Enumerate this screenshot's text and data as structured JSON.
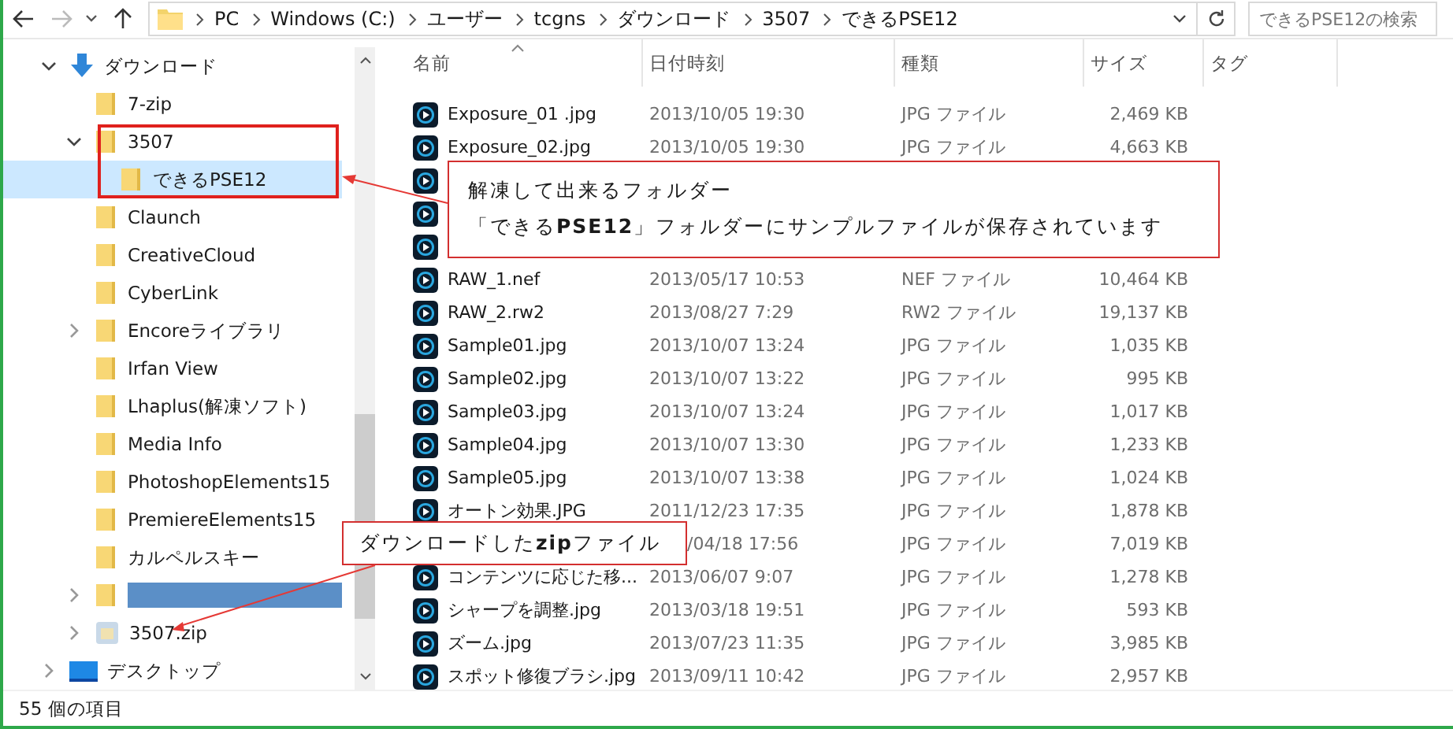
{
  "address_bar": {
    "segments": [
      "PC",
      "Windows (C:)",
      "ユーザー",
      "tcgns",
      "ダウンロード",
      "3507",
      "できるPSE12"
    ]
  },
  "search": {
    "placeholder": "できるPSE12の検索"
  },
  "tree": [
    {
      "label": "ダウンロード",
      "kind": "download",
      "expanded": true,
      "selected": false,
      "children": [
        {
          "label": "7-zip",
          "kind": "folder",
          "selected": false
        },
        {
          "label": "3507",
          "kind": "folder",
          "expanded": true,
          "selected": false,
          "children": [
            {
              "label": "できるPSE12",
              "kind": "folder",
              "selected": true
            }
          ]
        },
        {
          "label": "Claunch",
          "kind": "folder",
          "selected": false
        },
        {
          "label": "CreativeCloud",
          "kind": "folder",
          "selected": false
        },
        {
          "label": "CyberLink",
          "kind": "folder",
          "selected": false
        },
        {
          "label": "Encoreライブラリ",
          "kind": "folder",
          "expanded": false,
          "selected": false
        },
        {
          "label": "Irfan View",
          "kind": "folder",
          "selected": false
        },
        {
          "label": "Lhaplus(解凍ソフト)",
          "kind": "folder",
          "selected": false
        },
        {
          "label": "Media Info",
          "kind": "folder",
          "selected": false
        },
        {
          "label": "PhotoshopElements15",
          "kind": "folder",
          "selected": false
        },
        {
          "label": "PremiereElements15",
          "kind": "folder",
          "selected": false
        },
        {
          "label": "カルペルスキー",
          "kind": "folder",
          "selected": false
        },
        {
          "kind": "redacted",
          "expanded": false,
          "selected": false
        },
        {
          "label": "3507.zip",
          "kind": "zip",
          "expanded": false,
          "selected": false
        }
      ]
    },
    {
      "label": "デスクトップ",
      "kind": "desktop",
      "expanded": false,
      "selected": false
    }
  ],
  "columns": [
    "名前",
    "日付時刻",
    "種類",
    "サイズ",
    "タグ"
  ],
  "files": [
    {
      "name": "Exposure_01 .jpg",
      "date": "2013/10/05 19:30",
      "type": "JPG ファイル",
      "size": "2,469 KB"
    },
    {
      "name": "Exposure_02.jpg",
      "date": "2013/10/05 19:30",
      "type": "JPG ファイル",
      "size": "4,663 KB"
    },
    {
      "kind": "covered"
    },
    {
      "kind": "covered"
    },
    {
      "kind": "covered"
    },
    {
      "name": "RAW_1.nef",
      "date": "2013/05/17 10:53",
      "type": "NEF ファイル",
      "size": "10,464 KB"
    },
    {
      "name": "RAW_2.rw2",
      "date": "2013/08/27 7:29",
      "type": "RW2 ファイル",
      "size": "19,137 KB"
    },
    {
      "name": "Sample01.jpg",
      "date": "2013/10/07 13:24",
      "type": "JPG ファイル",
      "size": "1,035 KB"
    },
    {
      "name": "Sample02.jpg",
      "date": "2013/10/07 13:22",
      "type": "JPG ファイル",
      "size": "995 KB"
    },
    {
      "name": "Sample03.jpg",
      "date": "2013/10/07 13:24",
      "type": "JPG ファイル",
      "size": "1,017 KB"
    },
    {
      "name": "Sample04.jpg",
      "date": "2013/10/07 13:30",
      "type": "JPG ファイル",
      "size": "1,233 KB"
    },
    {
      "name": "Sample05.jpg",
      "date": "2013/10/07 13:38",
      "type": "JPG ファイル",
      "size": "1,024 KB"
    },
    {
      "name": "オートン効果.JPG",
      "date": "2011/12/23 17:35",
      "type": "JPG ファイル",
      "size": "1,878 KB"
    },
    {
      "kind": "name-covered",
      "date": "/04/18 17:56",
      "type": "JPG ファイル",
      "size": "7,019 KB"
    },
    {
      "name": "コンテンツに応じた移...",
      "date": "2013/06/07 9:07",
      "type": "JPG ファイル",
      "size": "1,278 KB"
    },
    {
      "name": "シャープを調整.jpg",
      "date": "2013/03/18 19:51",
      "type": "JPG ファイル",
      "size": "593 KB"
    },
    {
      "name": "ズーム.jpg",
      "date": "2013/07/23 11:35",
      "type": "JPG ファイル",
      "size": "3,985 KB"
    },
    {
      "name": "スポット修復ブラシ.jpg",
      "date": "2013/09/11 10:42",
      "type": "JPG ファイル",
      "size": "2,957 KB"
    }
  ],
  "callouts": [
    {
      "lines": [
        "解凍して出来るフォルダー",
        "「できる**PSE12**」フォルダーにサンプルファイルが保存されています"
      ]
    },
    {
      "lines": [
        "ダウンロードした**zip**ファイル"
      ]
    }
  ],
  "status_bar": {
    "item_count": "55 個の項目"
  }
}
